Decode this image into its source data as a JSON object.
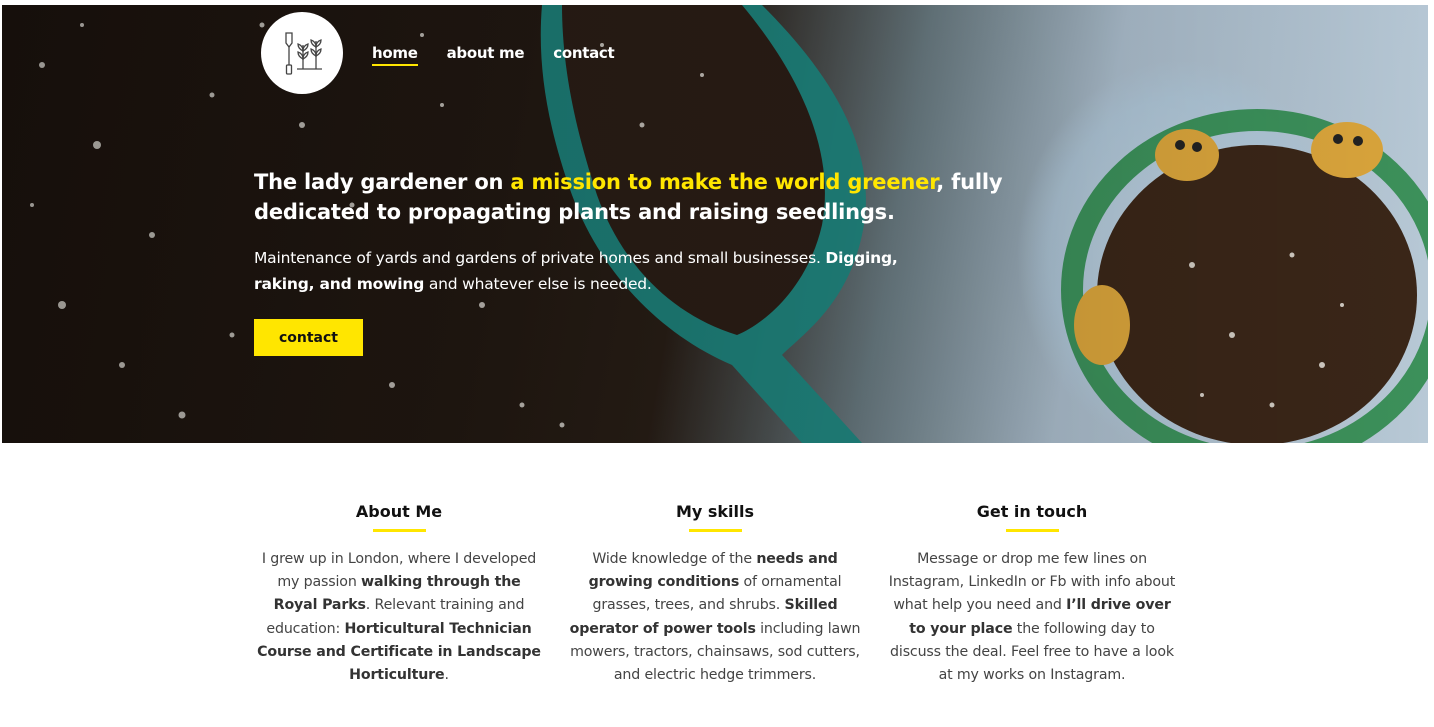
{
  "nav": {
    "items": [
      {
        "label": "home",
        "active": true
      },
      {
        "label": "about me",
        "active": false
      },
      {
        "label": "contact",
        "active": false
      }
    ]
  },
  "logo": {
    "icon": "garden-tools-icon"
  },
  "hero": {
    "headline_pre": "The lady gardener on ",
    "headline_highlight": "a mission to make the world greener",
    "headline_post": ", fully dedicated to propagating plants and raising seedlings.",
    "sub_pre": "Maintenance of yards and gardens of private homes and small businesses. ",
    "sub_bold": "Digging, raking, and mowing",
    "sub_post": " and whatever else is needed.",
    "button_label": "contact"
  },
  "columns": [
    {
      "title": "About Me",
      "parts": [
        {
          "text": "I grew up in London, where I developed my passion ",
          "bold": false
        },
        {
          "text": "walking through the Royal Parks",
          "bold": true
        },
        {
          "text": ". Relevant training and education: ",
          "bold": false
        },
        {
          "text": "Horticultural Technician Course and Certificate in Landscape Horticulture",
          "bold": true
        },
        {
          "text": ".",
          "bold": false
        }
      ]
    },
    {
      "title": "My skills",
      "parts": [
        {
          "text": "Wide knowledge of the ",
          "bold": false
        },
        {
          "text": "needs and growing conditions",
          "bold": true
        },
        {
          "text": " of ornamental grasses, trees, and shrubs. ",
          "bold": false
        },
        {
          "text": "Skilled operator of power tools",
          "bold": true
        },
        {
          "text": " including lawn mowers, tractors, chainsaws, sod cutters, and electric hedge trimmers.",
          "bold": false
        }
      ]
    },
    {
      "title": "Get in touch",
      "parts": [
        {
          "text": "Message or drop me few lines on Instagram, LinkedIn or Fb with info about what help you need and ",
          "bold": false
        },
        {
          "text": "I’ll drive over to your place",
          "bold": true
        },
        {
          "text": " the following day to discuss the deal. Feel free to have a look at my works on Instagram.",
          "bold": false
        }
      ]
    }
  ],
  "colors": {
    "accent": "#ffe600",
    "text": "#444444"
  }
}
